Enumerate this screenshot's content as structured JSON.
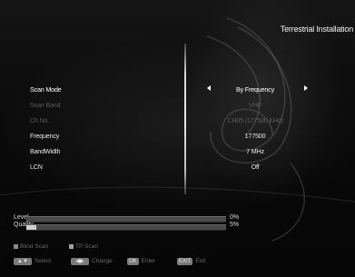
{
  "header": {
    "title": "Terrestrial Installation"
  },
  "settings": [
    {
      "label": "Scan Mode",
      "value": "By Frequency",
      "state": "selected"
    },
    {
      "label": "Scan Band",
      "value": "VHF",
      "state": "disabled"
    },
    {
      "label": "Ch No.",
      "value": "CH05 (177500 KHz)",
      "state": "disabled"
    },
    {
      "label": "Frequency",
      "value": "177500",
      "state": "normal"
    },
    {
      "label": "BandWidth",
      "value": "7 MHz",
      "state": "normal"
    },
    {
      "label": "LCN",
      "value": "Off",
      "state": "normal"
    }
  ],
  "meters": {
    "level": {
      "label": "Level",
      "percent_text": "0%",
      "fraction": 0.0
    },
    "quality": {
      "label": "Quality",
      "percent_text": "5%",
      "fraction": 0.05
    }
  },
  "legend": {
    "blind_scan": "Blind Scan",
    "tp_scan": "TP Scan",
    "select": "Select",
    "change": "Change",
    "enter_key": "OK",
    "enter": "Enter",
    "exit_key": "EXIT",
    "exit": "Exit"
  },
  "colors": {
    "background": "#0b0b0b",
    "text": "#e6e6e6",
    "disabled_text": "#5b5b5b",
    "key_background": "#7a7a7a"
  }
}
